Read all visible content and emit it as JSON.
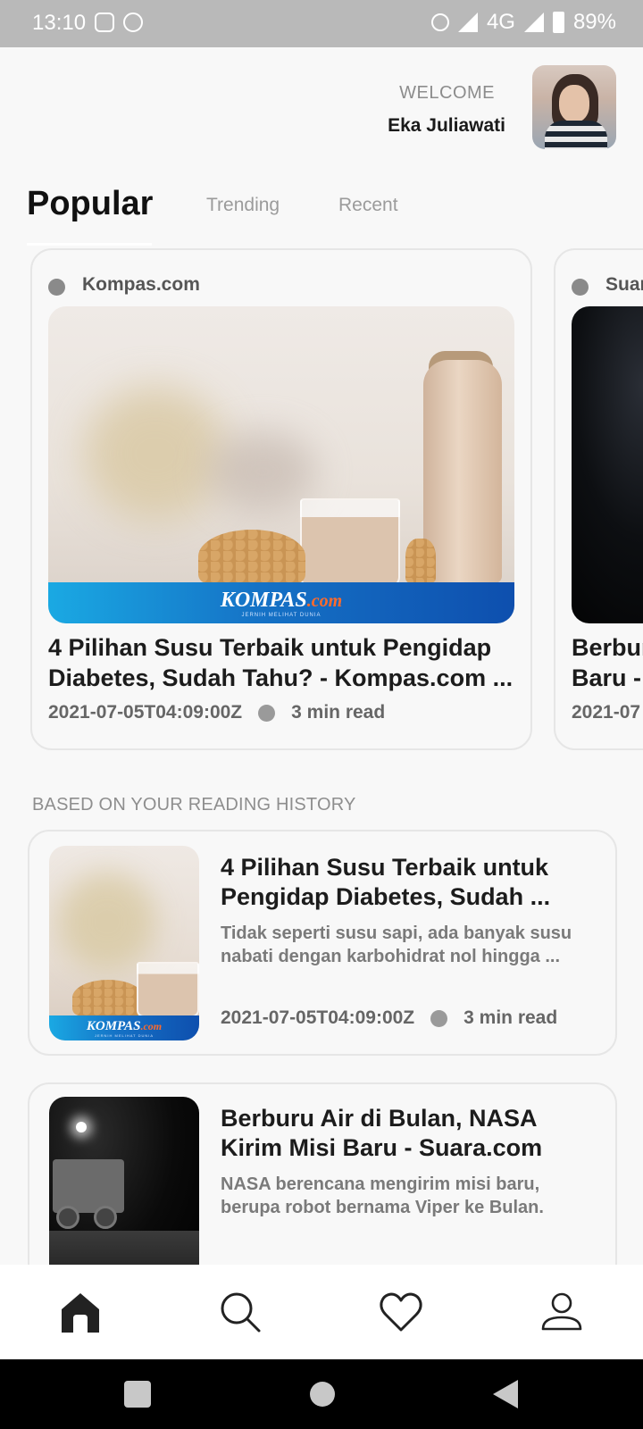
{
  "status_bar": {
    "time": "13:10",
    "network": "4G",
    "battery": "89%"
  },
  "header": {
    "welcome_label": "WELCOME",
    "user_name": "Eka Juliawati"
  },
  "tabs": [
    {
      "label": "Popular",
      "active": true
    },
    {
      "label": "Trending",
      "active": false
    },
    {
      "label": "Recent",
      "active": false
    }
  ],
  "popular": [
    {
      "source": "Kompas.com",
      "title_line1": "4 Pilihan Susu Terbaik untuk Pengidap",
      "title_line2": "Diabetes, Sudah Tahu? - Kompas.com ...",
      "image_brand": "KOMPAS",
      "image_brand_suffix": ".com",
      "image_tagline": "JERNIH MELIHAT DUNIA",
      "date": "2021-07-05T04:09:00Z",
      "read_time": "3 min read"
    },
    {
      "source": "Suar",
      "title_line1": "Berbur",
      "title_line2": "Baru -",
      "date": "2021-07"
    }
  ],
  "history": {
    "section_label": "BASED ON YOUR READING HISTORY",
    "items": [
      {
        "title": "4 Pilihan Susu Terbaik untuk Pengidap Diabetes, Sudah ...",
        "description": "Tidak seperti susu sapi, ada banyak susu nabati dengan karbohidrat nol hingga ...",
        "image_brand": "KOMPAS",
        "image_brand_suffix": ".com",
        "image_tagline": "JERNIH MELIHAT DUNIA",
        "date": "2021-07-05T04:09:00Z",
        "read_time": "3 min read"
      },
      {
        "title": "Berburu Air di Bulan, NASA Kirim Misi Baru - Suara.com",
        "description": "NASA berencana mengirim misi baru, berupa robot bernama Viper ke Bulan."
      }
    ]
  },
  "bottom_nav": [
    {
      "icon": "home-icon",
      "active": true
    },
    {
      "icon": "search-icon",
      "active": false
    },
    {
      "icon": "heart-icon",
      "active": false
    },
    {
      "icon": "profile-icon",
      "active": false
    }
  ],
  "colors": {
    "background": "#f8f8f8",
    "status_bar": "#b9b9b9",
    "nav_active": "#222222",
    "nav_inactive": "#222222"
  }
}
